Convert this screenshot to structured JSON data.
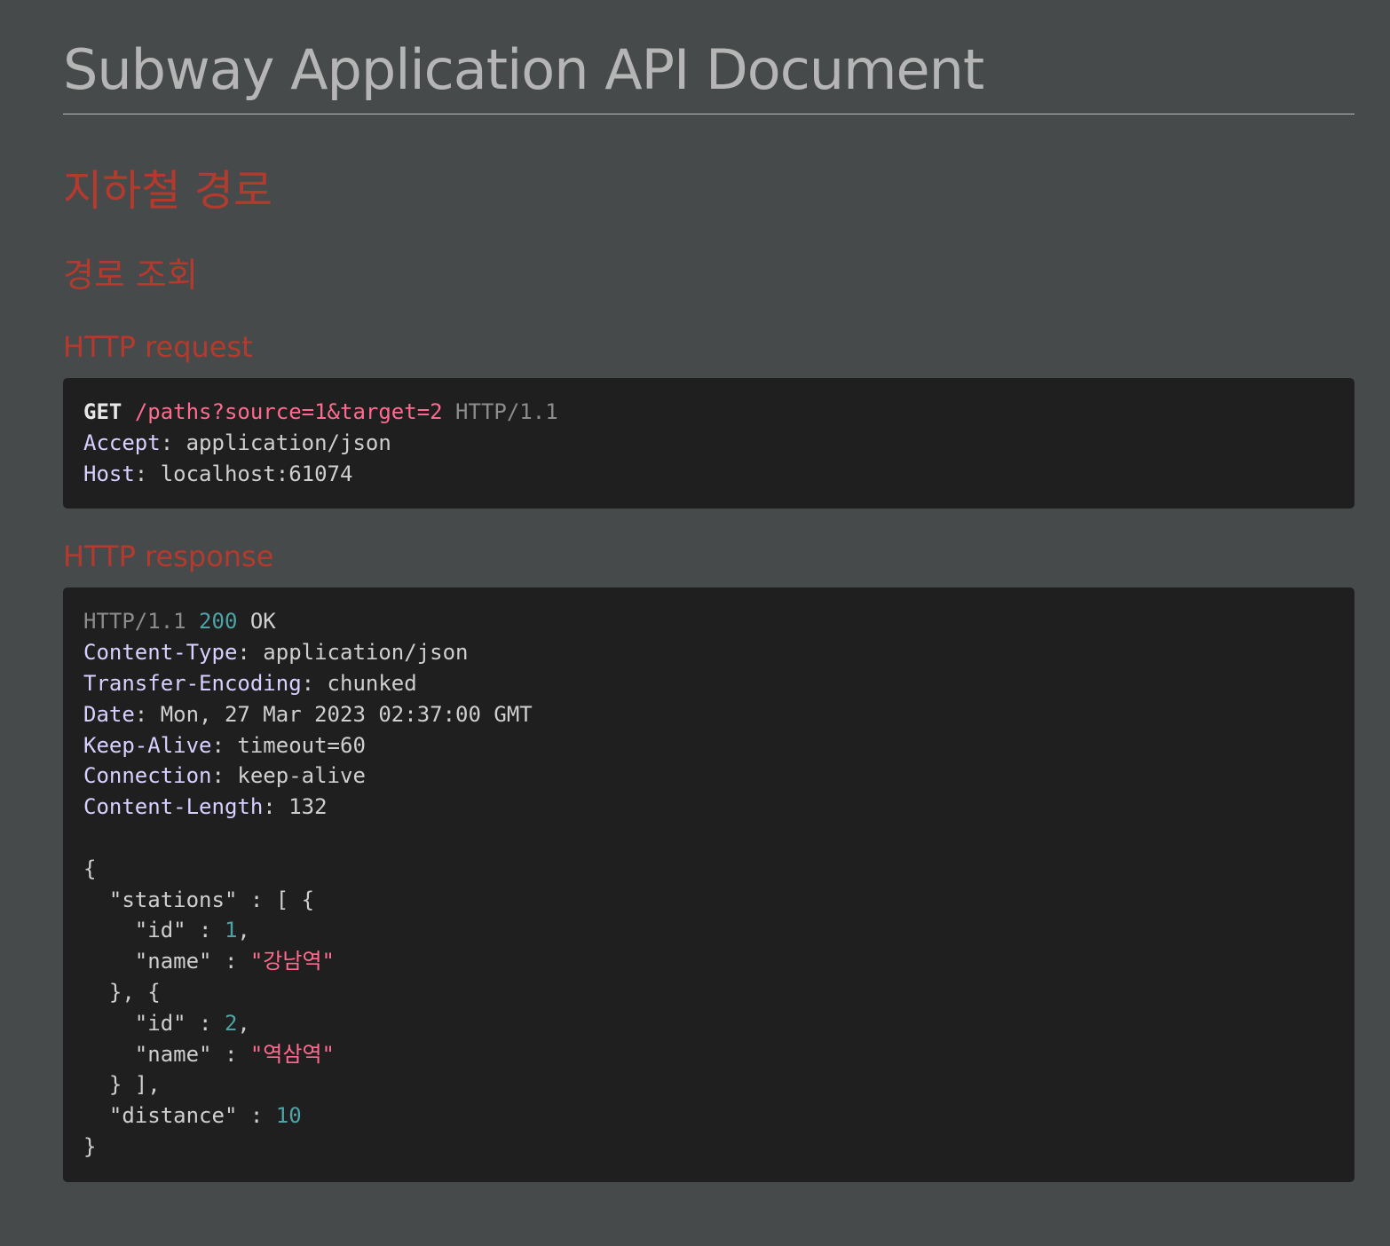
{
  "document": {
    "title": "Subway Application API Document"
  },
  "section": {
    "title": "지하철 경로",
    "subsection_title": "경로 조회"
  },
  "request": {
    "heading": "HTTP request",
    "method": "GET",
    "path": "/paths?source=1&target=2",
    "protocol": "HTTP/1.1",
    "headers": [
      {
        "name": "Accept",
        "value": "application/json"
      },
      {
        "name": "Host",
        "value": "localhost:61074"
      }
    ]
  },
  "response": {
    "heading": "HTTP response",
    "protocol": "HTTP/1.1",
    "status_code": "200",
    "status_text": "OK",
    "headers": [
      {
        "name": "Content-Type",
        "value": "application/json"
      },
      {
        "name": "Transfer-Encoding",
        "value": "chunked"
      },
      {
        "name": "Date",
        "value": "Mon, 27 Mar 2023 02:37:00 GMT"
      },
      {
        "name": "Keep-Alive",
        "value": "timeout=60"
      },
      {
        "name": "Connection",
        "value": "keep-alive"
      },
      {
        "name": "Content-Length",
        "value": "132"
      }
    ],
    "body": {
      "stations_key": "\"stations\"",
      "stations": [
        {
          "id_key": "\"id\"",
          "id": "1",
          "name_key": "\"name\"",
          "name": "\"강남역\""
        },
        {
          "id_key": "\"id\"",
          "id": "2",
          "name_key": "\"name\"",
          "name": "\"역삼역\""
        }
      ],
      "distance_key": "\"distance\"",
      "distance": "10"
    }
  },
  "colors": {
    "page_background": "#464a4b",
    "code_background": "#1f1f1f",
    "heading_accent": "#b53a2e",
    "string_color": "#ff6b8e",
    "number_color": "#4ea3a6",
    "header_name_color": "#d9d0ff"
  }
}
